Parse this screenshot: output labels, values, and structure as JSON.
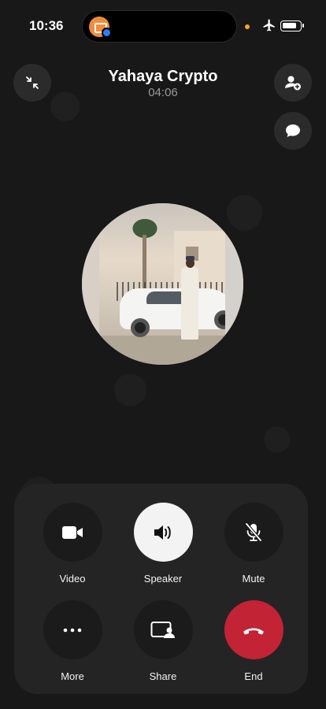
{
  "status_bar": {
    "time": "10:36"
  },
  "call": {
    "caller_name": "Yahaya Crypto",
    "duration": "04:06"
  },
  "controls": [
    {
      "label": "Video",
      "icon": "video-camera-icon",
      "active": false
    },
    {
      "label": "Speaker",
      "icon": "speaker-icon",
      "active": true
    },
    {
      "label": "Mute",
      "icon": "mic-off-icon",
      "active": false
    },
    {
      "label": "More",
      "icon": "more-dots-icon",
      "active": false
    },
    {
      "label": "Share",
      "icon": "screen-share-icon",
      "active": false
    },
    {
      "label": "End",
      "icon": "end-call-icon",
      "active": false
    }
  ],
  "colors": {
    "background": "#181818",
    "panel": "#242424",
    "end_call": "#c22335",
    "speaker_active": "#f3f3f3",
    "app_badge": "#f28c3b"
  }
}
